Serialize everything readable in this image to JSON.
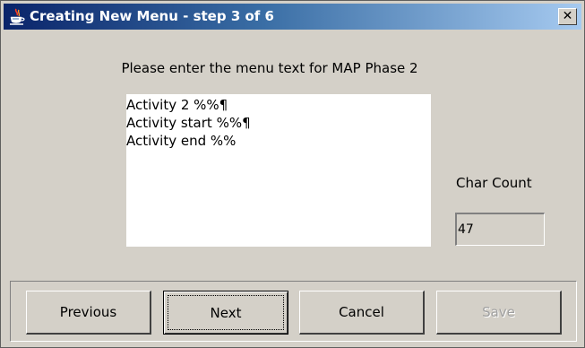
{
  "window": {
    "title": "Creating New Menu - step 3 of 6",
    "close_symbol": "✕"
  },
  "icons": {
    "title": "java-coffee-icon",
    "close": "close-icon"
  },
  "prompt": "Please enter the menu text for MAP Phase 2",
  "menu_text": {
    "value": "Activity 2 %%¶\nActivity start %%¶\nActivity end %%"
  },
  "char_count": {
    "label": "Char Count",
    "value": "47"
  },
  "buttons": {
    "previous": "Previous",
    "next": "Next",
    "cancel": "Cancel",
    "save": "Save"
  },
  "colors": {
    "title_gradient_start": "#0a246a",
    "title_gradient_end": "#a6caf0",
    "dialog_background": "#d4d0c8",
    "disabled_text": "#a0a0a0"
  }
}
